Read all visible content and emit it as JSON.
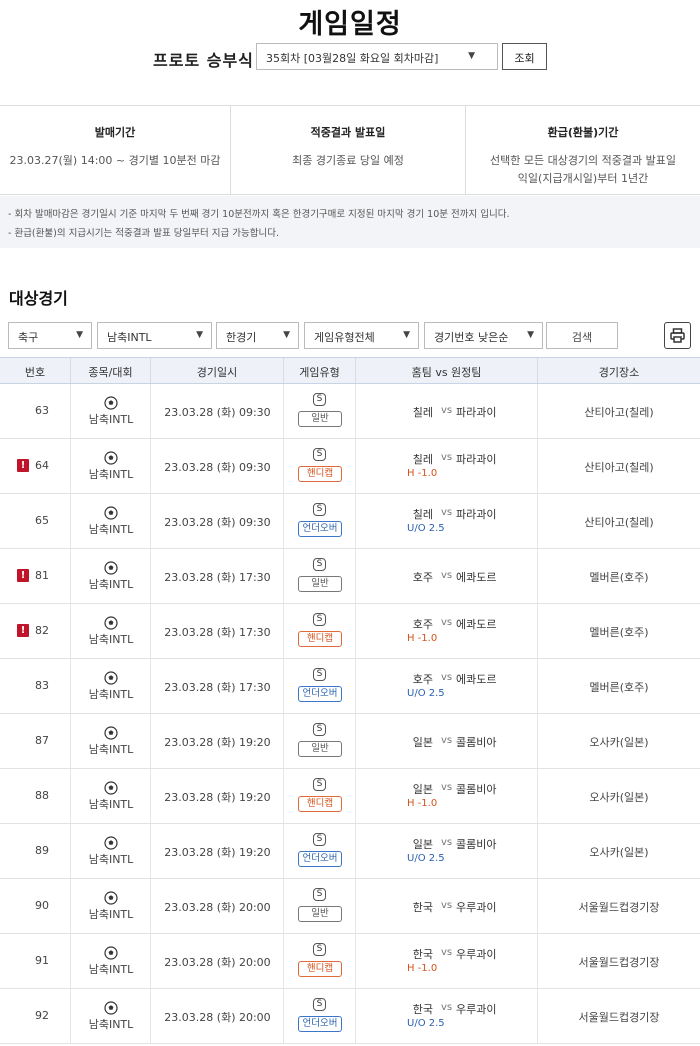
{
  "page_title": "게임일정",
  "round": {
    "label": "프로토 승부식",
    "selected": "35회차 [03월28일 화요일 회차마감]",
    "query_button": "조회"
  },
  "info": [
    {
      "heading": "발매기간",
      "lines": [
        "23.03.27(월) 14:00 ~ 경기별 10분전 마감"
      ]
    },
    {
      "heading": "적중결과 발표일",
      "lines": [
        "최종 경기종료 당일 예정"
      ]
    },
    {
      "heading": "환급(환불)기간",
      "lines": [
        "선택한 모든 대상경기의 적중결과 발표일",
        "익일(지급개시일)부터 1년간"
      ]
    }
  ],
  "notes": [
    "- 회차 발매마감은 경기일시 기준 마지막 두 번째 경기 10분전까지 혹은 한경기구매로 지정된 마지막 경기 10분 전까지 입니다.",
    "- 환급(환불)의 지급시기는 적중결과 발표 당일부터 지급 가능합니다."
  ],
  "section_title": "대상경기",
  "filters": {
    "sport": "축구",
    "league": "남축INTL",
    "match_count": "한경기",
    "game_type": "게임유형전체",
    "sort": "경기번호 낮은순",
    "search_placeholder": "검색",
    "print_icon": "printer-icon"
  },
  "columns": [
    "번호",
    "종목/대회",
    "경기일시",
    "게임유형",
    "홈팀 vs 원정팀",
    "경기장소"
  ],
  "vs_label": "vs",
  "s_label": "S",
  "sport_icon": "soccer-ball-icon",
  "alert_label": "!",
  "rows": [
    {
      "no": "63",
      "alert": false,
      "sport": "남축INTL",
      "date": "23.03.28 (화) 09:30",
      "type": "일반",
      "type_kind": "normal",
      "home": "칠레",
      "away": "파라과이",
      "line": "",
      "venue": "산티아고(칠레)"
    },
    {
      "no": "64",
      "alert": true,
      "sport": "남축INTL",
      "date": "23.03.28 (화) 09:30",
      "type": "핸디캡",
      "type_kind": "handicap",
      "home": "칠레",
      "away": "파라과이",
      "line": "H -1.0",
      "venue": "산티아고(칠레)"
    },
    {
      "no": "65",
      "alert": false,
      "sport": "남축INTL",
      "date": "23.03.28 (화) 09:30",
      "type": "언더오버",
      "type_kind": "uo",
      "home": "칠레",
      "away": "파라과이",
      "line": "U/O 2.5",
      "venue": "산티아고(칠레)"
    },
    {
      "no": "81",
      "alert": true,
      "sport": "남축INTL",
      "date": "23.03.28 (화) 17:30",
      "type": "일반",
      "type_kind": "normal",
      "home": "호주",
      "away": "에콰도르",
      "line": "",
      "venue": "멜버른(호주)"
    },
    {
      "no": "82",
      "alert": true,
      "sport": "남축INTL",
      "date": "23.03.28 (화) 17:30",
      "type": "핸디캡",
      "type_kind": "handicap",
      "home": "호주",
      "away": "에콰도르",
      "line": "H -1.0",
      "venue": "멜버른(호주)"
    },
    {
      "no": "83",
      "alert": false,
      "sport": "남축INTL",
      "date": "23.03.28 (화) 17:30",
      "type": "언더오버",
      "type_kind": "uo",
      "home": "호주",
      "away": "에콰도르",
      "line": "U/O 2.5",
      "venue": "멜버른(호주)"
    },
    {
      "no": "87",
      "alert": false,
      "sport": "남축INTL",
      "date": "23.03.28 (화) 19:20",
      "type": "일반",
      "type_kind": "normal",
      "home": "일본",
      "away": "콜롬비아",
      "line": "",
      "venue": "오사카(일본)"
    },
    {
      "no": "88",
      "alert": false,
      "sport": "남축INTL",
      "date": "23.03.28 (화) 19:20",
      "type": "핸디캡",
      "type_kind": "handicap",
      "home": "일본",
      "away": "콜롬비아",
      "line": "H -1.0",
      "venue": "오사카(일본)"
    },
    {
      "no": "89",
      "alert": false,
      "sport": "남축INTL",
      "date": "23.03.28 (화) 19:20",
      "type": "언더오버",
      "type_kind": "uo",
      "home": "일본",
      "away": "콜롬비아",
      "line": "U/O 2.5",
      "venue": "오사카(일본)"
    },
    {
      "no": "90",
      "alert": false,
      "sport": "남축INTL",
      "date": "23.03.28 (화) 20:00",
      "type": "일반",
      "type_kind": "normal",
      "home": "한국",
      "away": "우루과이",
      "line": "",
      "venue": "서울월드컵경기장"
    },
    {
      "no": "91",
      "alert": false,
      "sport": "남축INTL",
      "date": "23.03.28 (화) 20:00",
      "type": "핸디캡",
      "type_kind": "handicap",
      "home": "한국",
      "away": "우루과이",
      "line": "H -1.0",
      "venue": "서울월드컵경기장"
    },
    {
      "no": "92",
      "alert": false,
      "sport": "남축INTL",
      "date": "23.03.28 (화) 20:00",
      "type": "언더오버",
      "type_kind": "uo",
      "home": "한국",
      "away": "우루과이",
      "line": "U/O 2.5",
      "venue": "서울월드컵경기장"
    }
  ]
}
